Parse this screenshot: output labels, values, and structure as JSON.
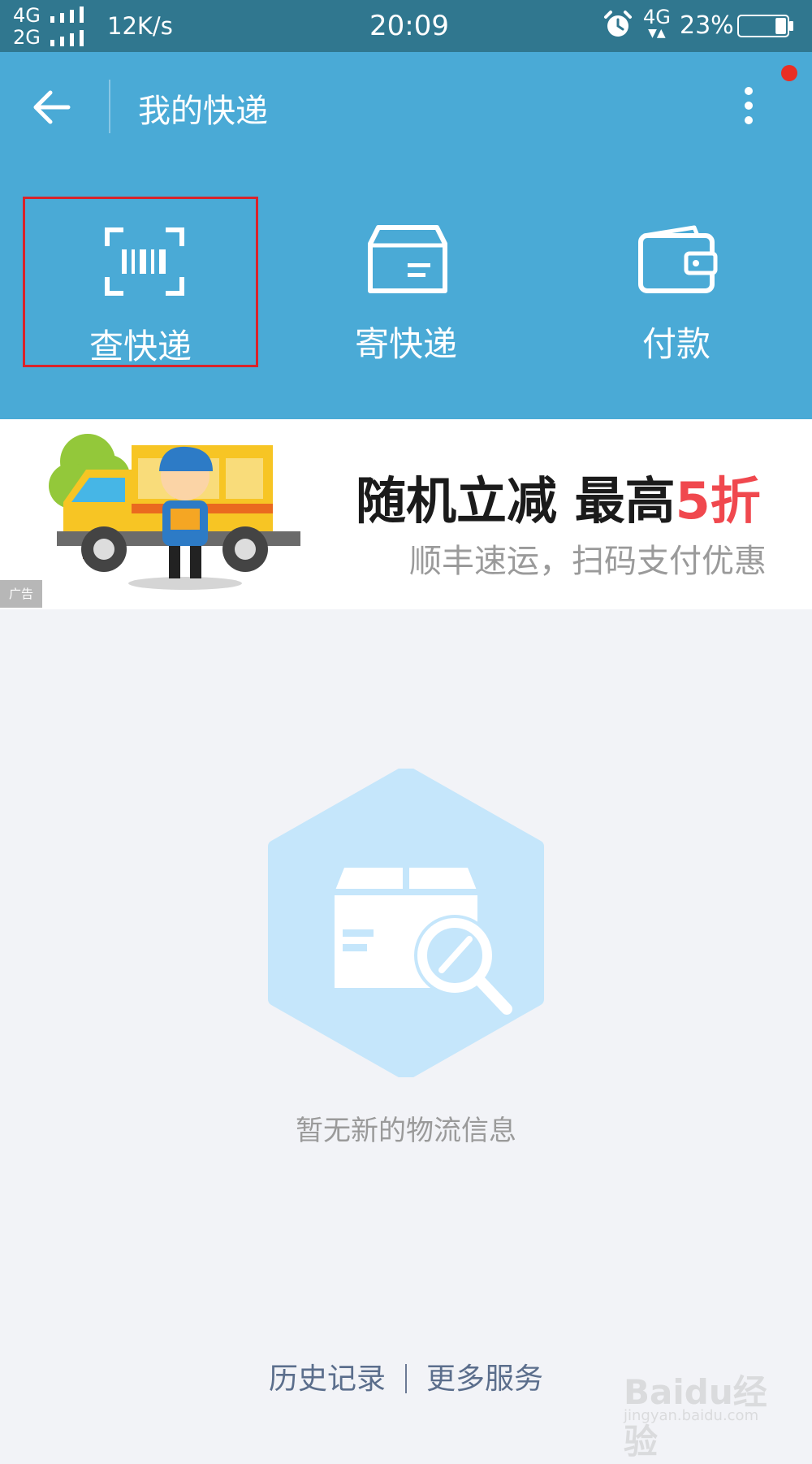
{
  "status_bar": {
    "net_top": "4G",
    "net_bottom": "2G",
    "speed": "12K/s",
    "time": "20:09",
    "data_net": "4G",
    "battery_percent": "23%",
    "battery_level": 0.23
  },
  "header": {
    "title": "我的快递",
    "actions": [
      {
        "label": "查快递",
        "icon": "barcode-scan-icon"
      },
      {
        "label": "寄快递",
        "icon": "package-box-icon"
      },
      {
        "label": "付款",
        "icon": "wallet-icon"
      }
    ]
  },
  "ad": {
    "headline": "随机立减 最高",
    "highlight": "5折",
    "subtitle": "顺丰速运，扫码支付优惠",
    "tag": "广告"
  },
  "empty_state": {
    "message": "暂无新的物流信息"
  },
  "footer": {
    "history": "历史记录",
    "more_services": "更多服务"
  },
  "watermark": {
    "brand": "Baidu经验",
    "url": "jingyan.baidu.com"
  },
  "colors": {
    "status_bar": "#30778f",
    "header": "#4aaad6",
    "highlight_box": "#d9232b",
    "page_bg": "#f2f3f7",
    "ad_accent": "#f0484e"
  }
}
